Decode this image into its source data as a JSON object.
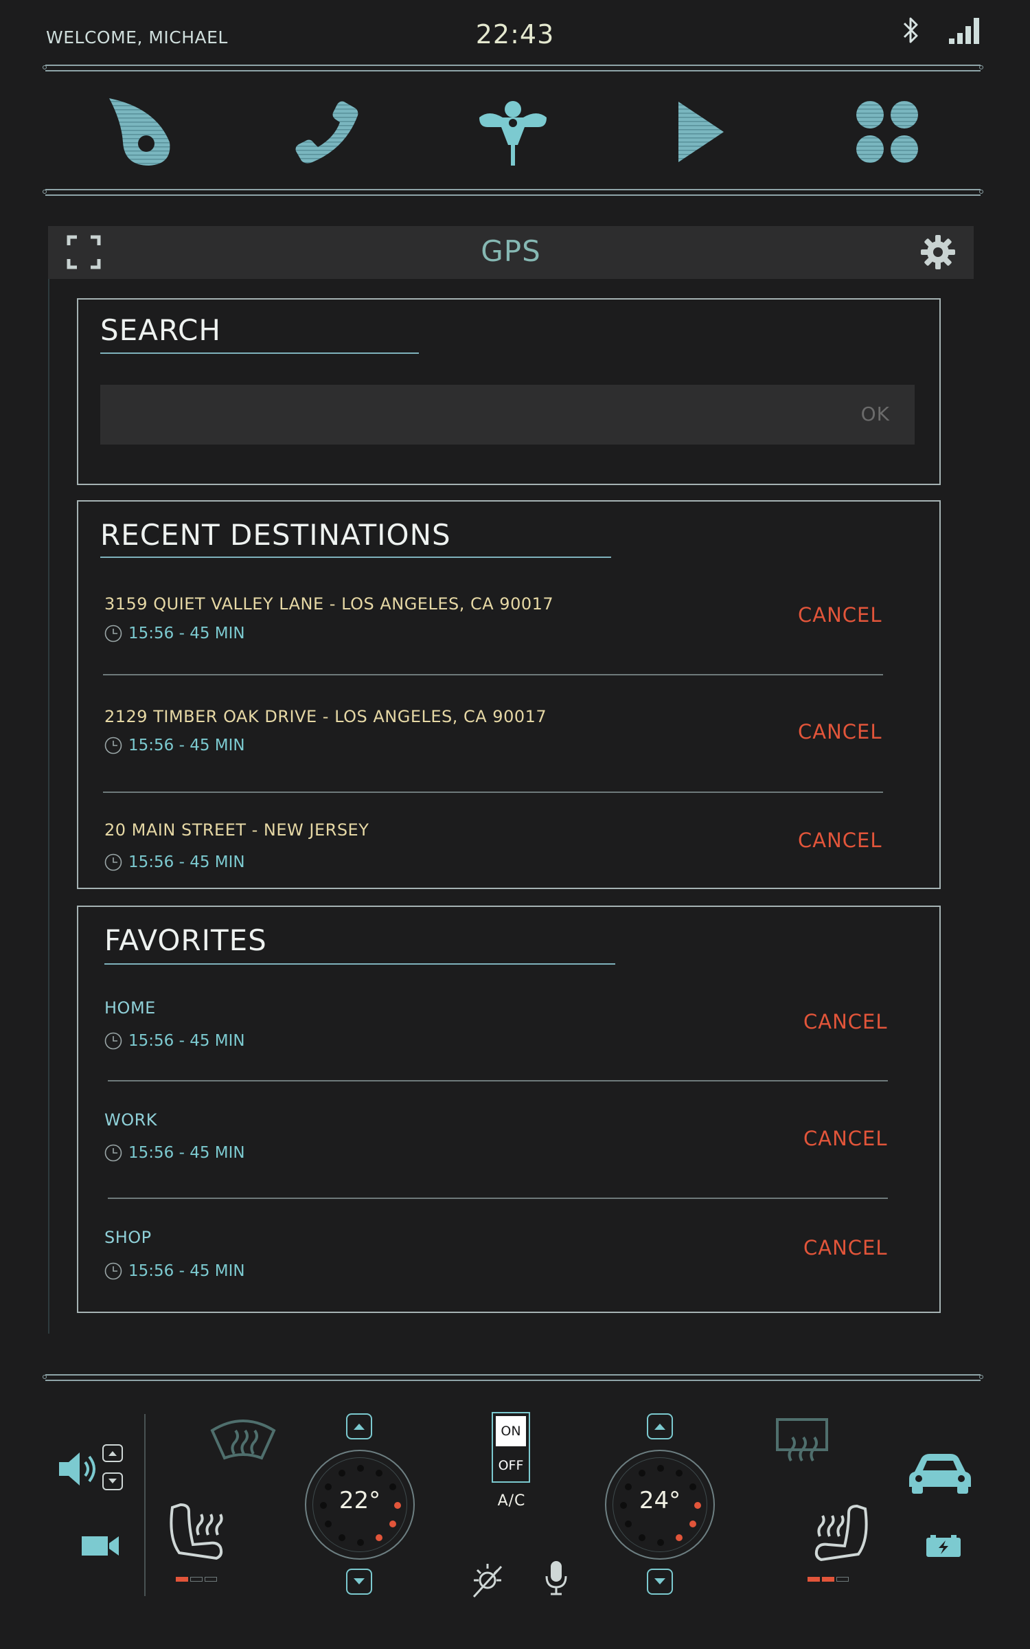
{
  "status_bar": {
    "welcome": "WELCOME, MICHAEL",
    "time": "22:43",
    "icons": [
      "bluetooth-icon",
      "signal-icon"
    ]
  },
  "nav": {
    "items": [
      {
        "icon": "map-pin-icon"
      },
      {
        "icon": "phone-icon"
      },
      {
        "icon": "navigation-icon"
      },
      {
        "icon": "play-icon"
      },
      {
        "icon": "apps-icon"
      }
    ]
  },
  "gps": {
    "title": "GPS",
    "expand_icon": "fullscreen-icon",
    "settings_icon": "gear-icon"
  },
  "search": {
    "title": "SEARCH",
    "input_value": "",
    "ok_label": "OK"
  },
  "recent": {
    "title": "RECENT DESTINATIONS",
    "items": [
      {
        "address": "3159 QUIET VALLEY LANE - LOS ANGELES, CA 90017",
        "meta": "15:56 - 45 MIN",
        "cancel": "CANCEL"
      },
      {
        "address": "2129 TIMBER OAK DRIVE - LOS ANGELES, CA 90017",
        "meta": "15:56 - 45 MIN",
        "cancel": "CANCEL"
      },
      {
        "address": "20 MAIN STREET - NEW JERSEY",
        "meta": "15:56 - 45 MIN",
        "cancel": "CANCEL"
      }
    ]
  },
  "favorites": {
    "title": "FAVORITES",
    "items": [
      {
        "name": "HOME",
        "meta": "15:56 - 45 MIN",
        "cancel": "CANCEL"
      },
      {
        "name": "WORK",
        "meta": "15:56 - 45 MIN",
        "cancel": "CANCEL"
      },
      {
        "name": "SHOP",
        "meta": "15:56 - 45 MIN",
        "cancel": "CANCEL"
      }
    ]
  },
  "climate": {
    "left_temp": "22°",
    "right_temp": "24°",
    "ac_on": "ON",
    "ac_off": "OFF",
    "ac_label": "A/C",
    "left_seat_heat_level": 1,
    "right_seat_heat_level": 2,
    "seat_heat_max": 3
  },
  "colors": {
    "accent": "#7ccad0",
    "cancel": "#e2553a",
    "address": "#e6d8a5",
    "background": "#1c1c1d"
  }
}
